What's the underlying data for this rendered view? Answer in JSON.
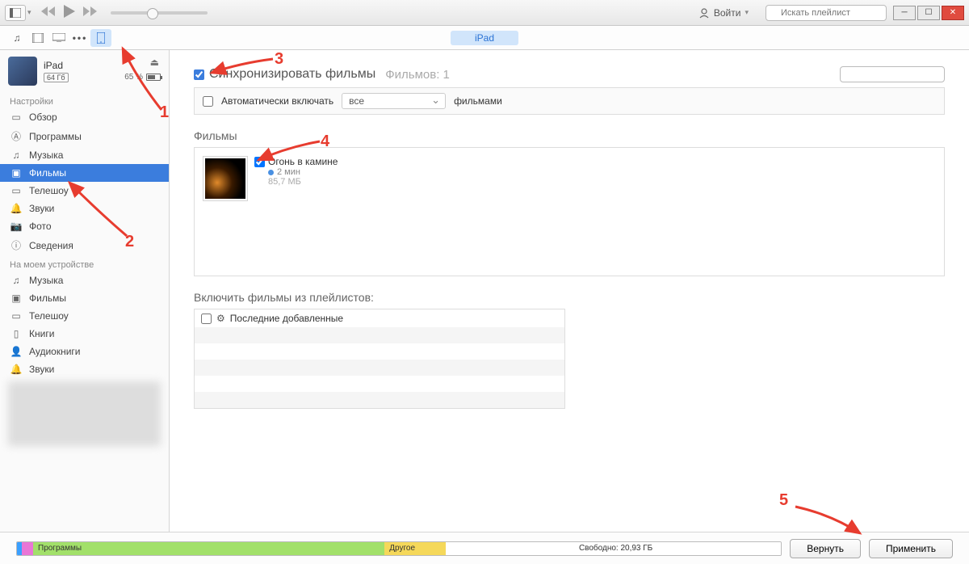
{
  "top": {
    "account_label": "Войти",
    "search_placeholder": "Искать плейлист"
  },
  "nav": {
    "device_pill": "iPad"
  },
  "device": {
    "name": "iPad",
    "capacity": "64 Гб",
    "battery": "65 %"
  },
  "sidebar": {
    "section_settings": "Настройки",
    "settings_items": [
      {
        "icon": "browse",
        "label": "Обзор"
      },
      {
        "icon": "apps",
        "label": "Программы"
      },
      {
        "icon": "music",
        "label": "Музыка"
      },
      {
        "icon": "movies",
        "label": "Фильмы",
        "active": true
      },
      {
        "icon": "tv",
        "label": "Телешоу"
      },
      {
        "icon": "sounds",
        "label": "Звуки"
      },
      {
        "icon": "photos",
        "label": "Фото"
      },
      {
        "icon": "info",
        "label": "Сведения"
      }
    ],
    "section_device": "На моем устройстве",
    "device_items": [
      {
        "icon": "music",
        "label": "Музыка"
      },
      {
        "icon": "movies",
        "label": "Фильмы"
      },
      {
        "icon": "tv",
        "label": "Телешоу"
      },
      {
        "icon": "books",
        "label": "Книги"
      },
      {
        "icon": "audiobooks",
        "label": "Аудиокниги"
      },
      {
        "icon": "sounds",
        "label": "Звуки"
      }
    ]
  },
  "main": {
    "sync_label": "Синхронизировать фильмы",
    "sync_count": "Фильмов: 1",
    "auto_include": "Автоматически включать",
    "auto_select": "все",
    "auto_suffix": "фильмами",
    "movies_header": "Фильмы",
    "movie": {
      "title": "Огонь в камине",
      "duration": "2 мин",
      "size": "85,7 МБ"
    },
    "playlists_header": "Включить фильмы из плейлистов:",
    "playlist_recent": "Последние добавленные"
  },
  "annotations": {
    "n1": "1",
    "n2": "2",
    "n3": "3",
    "n4": "4",
    "n5": "5"
  },
  "bottom": {
    "seg_apps": "Программы",
    "seg_other": "Другое",
    "seg_free": "Свободно: 20,93 ГБ",
    "btn_revert": "Вернуть",
    "btn_apply": "Применить"
  }
}
